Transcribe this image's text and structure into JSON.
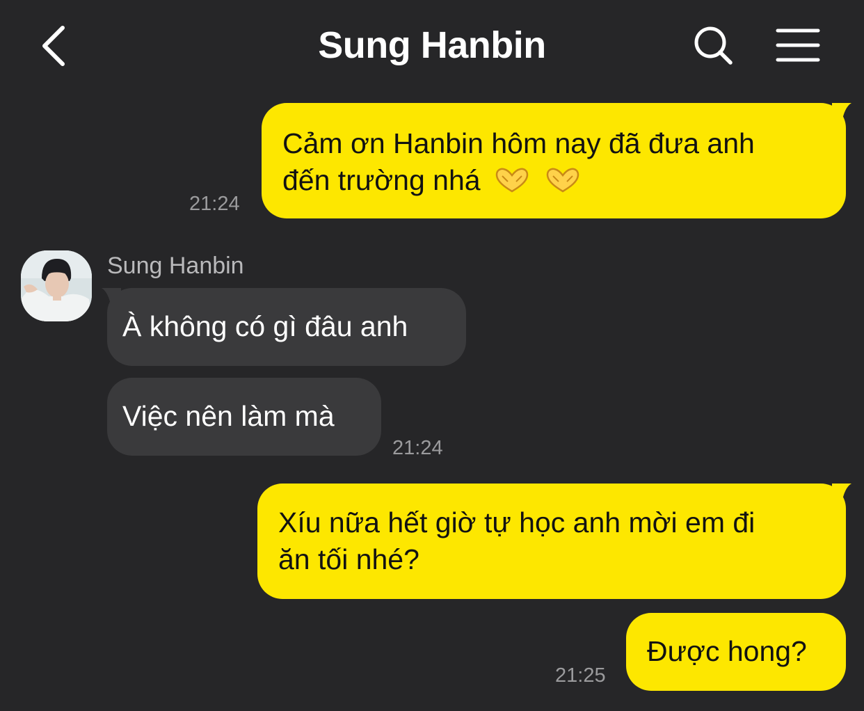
{
  "header": {
    "title": "Sung Hanbin",
    "back_icon": "chevron-left-icon",
    "search_icon": "search-icon",
    "menu_icon": "hamburger-menu-icon"
  },
  "messages": [
    {
      "direction": "outgoing",
      "text_line1": "Cảm ơn Hanbin hôm nay đã đưa anh",
      "text_line2": "đến trường nhá",
      "emoji": [
        "heart-hands-emoji",
        "heart-hands-emoji"
      ],
      "time": "21:24"
    },
    {
      "direction": "incoming",
      "sender": "Sung Hanbin",
      "text": "À không có gì đâu anh"
    },
    {
      "direction": "incoming",
      "text": "Việc nên làm mà",
      "time": "21:24"
    },
    {
      "direction": "outgoing",
      "text_line1": "Xíu nữa hết giờ tự học anh mời em đi",
      "text_line2": "ăn tối nhé?"
    },
    {
      "direction": "outgoing",
      "text": "Được hong?",
      "time": "21:25"
    }
  ],
  "colors": {
    "background": "#262628",
    "outgoing_bubble": "#fde700",
    "incoming_bubble": "#3a3a3c",
    "timestamp": "#9b9b9d"
  }
}
